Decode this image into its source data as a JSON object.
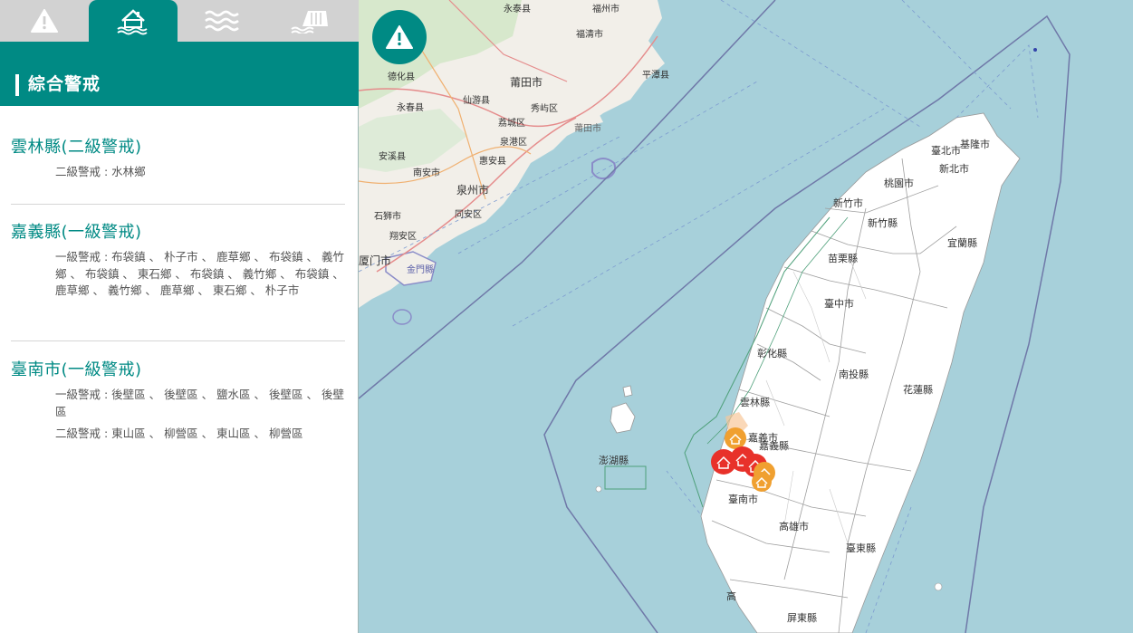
{
  "panel": {
    "title": "綜合警戒",
    "tabs": [
      {
        "icon": "warning-icon",
        "active": false
      },
      {
        "icon": "flooded-house-icon",
        "active": true
      },
      {
        "icon": "water-waves-icon",
        "active": false
      },
      {
        "icon": "dam-icon",
        "active": false
      }
    ],
    "regions": [
      {
        "title": "雲林縣(二級警戒)",
        "lines": [
          "二級警戒 : 水林鄉"
        ]
      },
      {
        "title": "嘉義縣(一級警戒)",
        "lines": [
          "一級警戒 : 布袋鎮 、 朴子市 、 鹿草鄉 、 布袋鎮 、 義竹鄉 、 布袋鎮 、 東石鄉 、 布袋鎮 、 義竹鄉 、 布袋鎮 、 鹿草鄉 、 義竹鄉 、 鹿草鄉 、 東石鄉 、 朴子市"
        ]
      },
      {
        "title": "臺南市(一級警戒)",
        "lines": [
          "一級警戒 : 後壁區 、 後壁區 、 鹽水區 、 後壁區 、 後壁區",
          "二級警戒 : 東山區 、 柳營區 、 東山區 、 柳營區"
        ]
      }
    ]
  },
  "map": {
    "mainland_labels": [
      "永泰县",
      "福州市",
      "福清市",
      "平潭县",
      "德化县",
      "莆田市",
      "仙游县",
      "永春县",
      "秀屿区",
      "荔城区",
      "莆田市",
      "安溪县",
      "泉港区",
      "南安市",
      "惠安县",
      "泉州市",
      "同安区",
      "石狮市",
      "翔安区",
      "厦门市",
      "金門縣"
    ],
    "taiwan_labels": [
      "基隆市",
      "臺北市",
      "新北市",
      "桃園市",
      "新竹市",
      "新竹縣",
      "宜蘭縣",
      "苗栗縣",
      "臺中市",
      "彰化縣",
      "南投縣",
      "花蓮縣",
      "雲林縣",
      "嘉義市",
      "嘉義縣",
      "澎湖縣",
      "臺南市",
      "高雄市",
      "臺東縣",
      "屏東縣",
      "高"
    ],
    "colors": {
      "sea": "#a7d0da",
      "land_mainland": "#f2efe9",
      "land_taiwan": "#ffffff",
      "level1_marker": "#e8312a",
      "level2_marker": "#f0a030",
      "accent": "#008a84"
    },
    "markers": [
      {
        "level": 2,
        "icon": "flooded-house-icon"
      },
      {
        "level": 1,
        "icon": "flooded-house-icon"
      },
      {
        "level": 1,
        "icon": "flooded-house-icon"
      },
      {
        "level": 1,
        "icon": "flooded-house-icon"
      },
      {
        "level": 2,
        "icon": "flooded-house-icon"
      },
      {
        "level": 2,
        "icon": "flooded-house-icon"
      }
    ]
  }
}
